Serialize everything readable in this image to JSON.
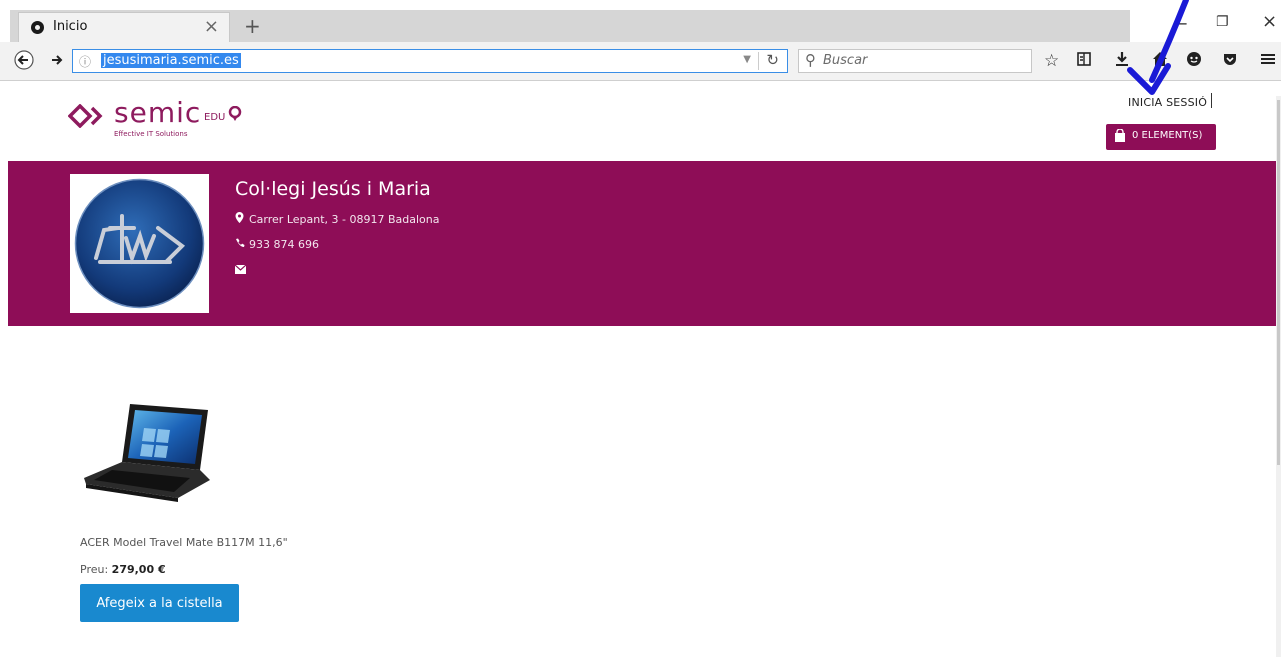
{
  "browser": {
    "tab_title": "Inicio",
    "tab_close": "×",
    "new_tab": "+",
    "url": "jesusimaria.semic.es",
    "search_placeholder": "Buscar",
    "minimize": "−",
    "restore": "❐",
    "close": "×"
  },
  "header": {
    "logo_text": "semic",
    "logo_edu": "EDU",
    "logo_tagline": "Effective IT Solutions",
    "login_label": "INICIA SESSIÓ",
    "cart_label": "0 ELEMENT(S)"
  },
  "school": {
    "name": "Col·legi Jesús i Maria",
    "address": "Carrer Lepant, 3 - 08917 Badalona",
    "phone": "933 874 696"
  },
  "product": {
    "name": "ACER Model Travel Mate B117M 11,6\"",
    "price_label": "Preu:",
    "price_value": "279,00 €",
    "add_button": "Afegeix a la cistella"
  },
  "colors": {
    "brand": "#8e0d57",
    "button": "#1989cf",
    "annotation_arrow": "#1a1ad6"
  }
}
